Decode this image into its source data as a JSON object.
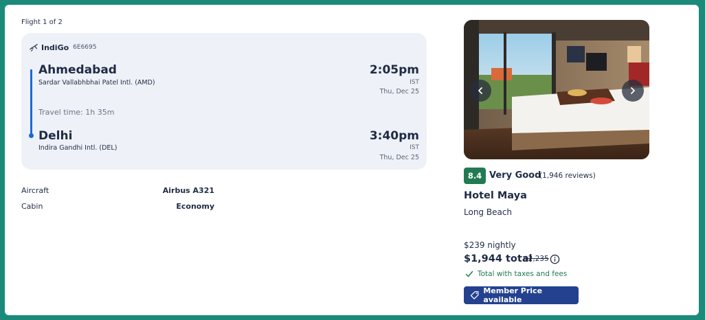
{
  "flight": {
    "count_label": "Flight 1 of 2",
    "airline": "IndiGo",
    "flight_number": "6E6695",
    "departure": {
      "city": "Ahmedabad",
      "airport": "Sardar Vallabhbhai Patel Intl. (AMD)",
      "time": "2:05pm",
      "timezone": "IST",
      "date": "Thu, Dec 25"
    },
    "travel_time": "Travel time: 1h 35m",
    "arrival": {
      "city": "Delhi",
      "airport": "Indira Gandhi Intl. (DEL)",
      "time": "3:40pm",
      "timezone": "IST",
      "date": "Thu, Dec 25"
    },
    "details": [
      {
        "label": "Aircraft",
        "value": "Airbus A321"
      },
      {
        "label": "Cabin",
        "value": "Economy"
      }
    ],
    "icon": "airplane-icon"
  },
  "hotel": {
    "rating_score": "8.4",
    "rating_text": "Very Good",
    "reviews": "(1,946 reviews)",
    "name": "Hotel Maya",
    "location": "Long Beach",
    "nightly_price": "$239 nightly",
    "total_price": "$1,944 total",
    "original_price": "$2,235",
    "taxes_note": "Total with taxes and fees",
    "member_badge": "Member Price available",
    "icons": [
      "chevron-left-icon",
      "chevron-right-icon",
      "info-icon",
      "checkmark-icon",
      "tag-icon"
    ]
  },
  "colors": {
    "background": "#1b8a7a",
    "card": "#ffffff",
    "segment": "#eef1f7",
    "timeline": "#1a6ad6",
    "rating_badge": "#227a52",
    "member_badge": "#23418f",
    "text": "#1f2b45",
    "success_text": "#227a52"
  }
}
